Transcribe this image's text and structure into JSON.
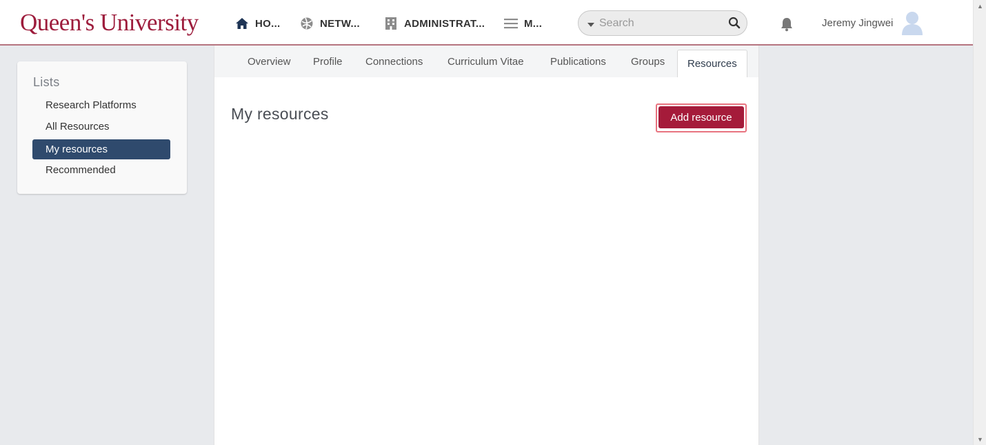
{
  "brand": {
    "logo_text": "Queen's University",
    "accent": "#9d1c3c"
  },
  "nav": {
    "items": [
      {
        "label": "HO...",
        "icon": "home-icon"
      },
      {
        "label": "NETW...",
        "icon": "network-globe-icon"
      },
      {
        "label": "ADMINISTRAT...",
        "icon": "building-icon"
      },
      {
        "label": "M...",
        "icon": "hamburger-menu-icon"
      }
    ]
  },
  "search": {
    "placeholder": "Search",
    "value": ""
  },
  "user": {
    "name": "Jeremy Jingwei"
  },
  "sidebar": {
    "title": "Lists",
    "items": [
      {
        "label": "Research Platforms",
        "active": false
      },
      {
        "label": "All Resources",
        "active": false
      },
      {
        "label": "My resources",
        "active": true
      },
      {
        "label": "Recommended",
        "active": false
      }
    ]
  },
  "tabs": [
    {
      "label": "Overview"
    },
    {
      "label": "Profile"
    },
    {
      "label": "Connections"
    },
    {
      "label": "Curriculum Vitae"
    },
    {
      "label": "Publications"
    },
    {
      "label": "Groups"
    },
    {
      "label": "Resources",
      "active": true
    }
  ],
  "main": {
    "title": "My resources",
    "add_button_label": "Add resource"
  }
}
